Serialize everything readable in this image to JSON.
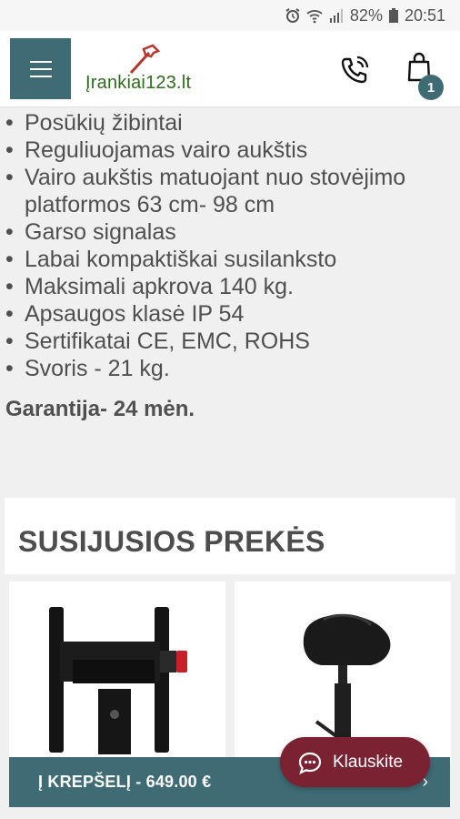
{
  "status_bar": {
    "battery": "82%",
    "time": "20:51"
  },
  "header": {
    "logo_text": "Įrankiai123.lt",
    "cart_count": "1"
  },
  "specs": {
    "items": [
      "Posūkių žibintai",
      "Reguliuojamas vairo aukštis",
      "Vairo aukštis matuojant nuo stovėjimo platformos 63 cm- 98 cm",
      "Garso signalas",
      "Labai kompaktiškai susilanksto",
      "Maksimali apkrova 140 kg.",
      "Apsaugos klasė IP 54",
      "Sertifikatai CE, EMC, ROHS",
      "Svoris - 21 kg."
    ]
  },
  "warranty": "Garantija- 24 mėn.",
  "related": {
    "title": "SUSIJUSIOS PREKĖS"
  },
  "cart_bar": {
    "label": "Į KREPŠELĮ - 649.00 €"
  },
  "chat": {
    "label": "Klauskite"
  },
  "colors": {
    "accent": "#3f6b75",
    "chat": "#7a2232",
    "logo_green": "#2f6b1f",
    "logo_red": "#b5362b"
  },
  "icons": [
    "alarm-icon",
    "wifi-icon",
    "signal-icon",
    "battery-icon",
    "hamburger-menu-icon",
    "phone-icon",
    "shopping-bag-icon",
    "chat-bubble-icon"
  ]
}
